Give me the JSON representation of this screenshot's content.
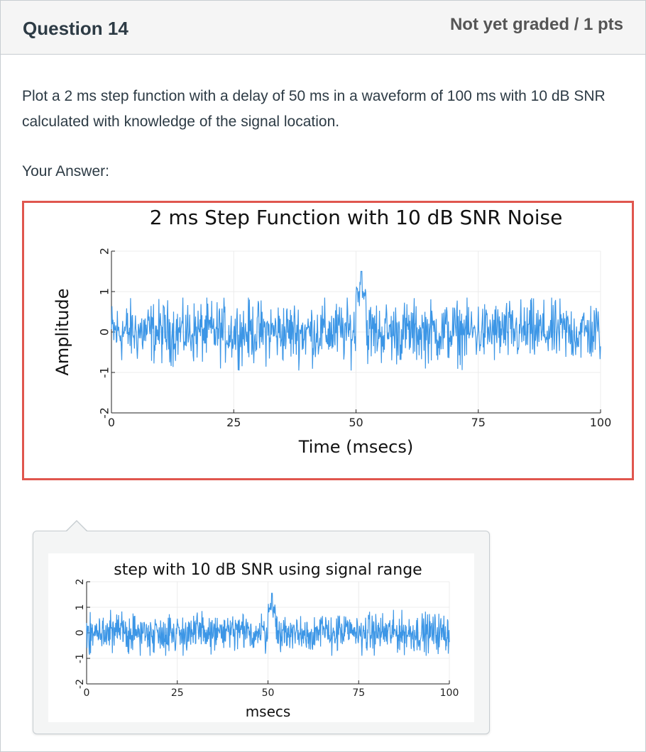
{
  "question": {
    "title": "Question 14",
    "points": "Not yet graded / 1 pts",
    "text": "Plot a 2 ms step function with a delay of 50 ms in a waveform of 100 ms with 10 dB SNR calculated with knowledge of the signal location.",
    "answer_label": "Your Answer:"
  },
  "colors": {
    "series": "#3c96e6",
    "answer_border": "#e0564e"
  },
  "chart_data": [
    {
      "type": "line",
      "title": "2 ms Step Function with 10 dB SNR Noise",
      "xlabel": "Time (msecs)",
      "ylabel": "Amplitude",
      "xlim": [
        0,
        100
      ],
      "ylim": [
        -2,
        2
      ],
      "xticks": [
        "0",
        "25",
        "50",
        "75",
        "100"
      ],
      "yticks": [
        "2",
        "1",
        "0",
        "-1",
        "-2"
      ],
      "grid": true,
      "legend": "none",
      "signal": {
        "step_start": 50,
        "step_width": 2,
        "step_amplitude": 1,
        "noise_range": [
          -0.95,
          0.85
        ],
        "peak": 1.5
      }
    },
    {
      "type": "line",
      "title": "step with 10 dB SNR using signal range",
      "xlabel": "msecs",
      "ylabel": "",
      "xlim": [
        0,
        100
      ],
      "ylim": [
        -2,
        2
      ],
      "xticks": [
        "0",
        "25",
        "50",
        "75",
        "100"
      ],
      "yticks": [
        "2",
        "1",
        "0",
        "-1",
        "-2"
      ],
      "grid": true,
      "legend": "none",
      "signal": {
        "step_start": 50,
        "step_width": 2,
        "step_amplitude": 1,
        "noise_range": [
          -0.9,
          0.9
        ],
        "peak": 1.55
      }
    }
  ]
}
